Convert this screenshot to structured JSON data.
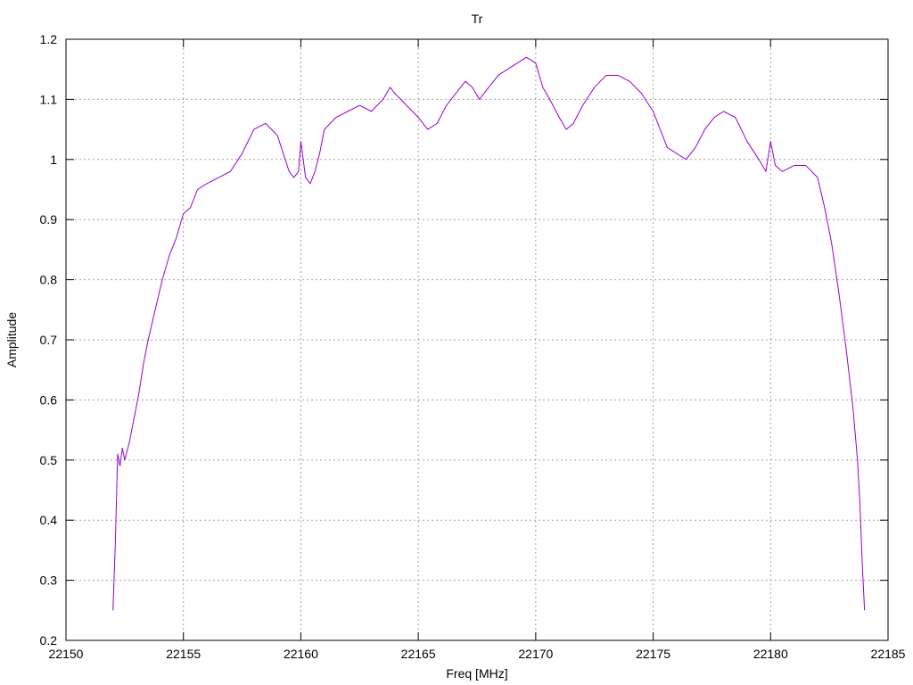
{
  "chart_data": {
    "type": "line",
    "title": "Tr",
    "xlabel": "Freq [MHz]",
    "ylabel": "Amplitude",
    "xlim": [
      22150,
      22185
    ],
    "ylim": [
      0.2,
      1.2
    ],
    "xticks": [
      22150,
      22155,
      22160,
      22165,
      22170,
      22175,
      22180,
      22185
    ],
    "yticks": [
      0.2,
      0.3,
      0.4,
      0.5,
      0.6,
      0.7,
      0.8,
      0.9,
      1,
      1.1,
      1.2
    ],
    "xtick_labels": [
      "22150",
      "22155",
      "22160",
      "22165",
      "22170",
      "22175",
      "22180",
      "22185"
    ],
    "ytick_labels": [
      "0.2",
      "0.3",
      "0.4",
      "0.5",
      "0.6",
      "0.7",
      "0.8",
      "0.9",
      "1",
      "1.1",
      "1.2"
    ],
    "grid": true,
    "legend": "none",
    "series": [
      {
        "color": "#9400d3",
        "x": [
          22152.0,
          22152.1,
          22152.2,
          22152.3,
          22152.4,
          22152.5,
          22152.7,
          22152.9,
          22153.1,
          22153.3,
          22153.5,
          22153.8,
          22154.1,
          22154.4,
          22154.7,
          22155.0,
          22155.3,
          22155.6,
          22156.0,
          22156.5,
          22157.0,
          22157.5,
          22158.0,
          22158.5,
          22159.0,
          22159.5,
          22159.7,
          22159.9,
          22160.0,
          22160.2,
          22160.4,
          22160.6,
          22160.8,
          22161.0,
          22161.5,
          22162.0,
          22162.5,
          22163.0,
          22163.5,
          22163.8,
          22164.0,
          22164.5,
          22165.0,
          22165.4,
          22165.8,
          22166.2,
          22166.6,
          22167.0,
          22167.3,
          22167.6,
          22168.0,
          22168.4,
          22168.8,
          22169.2,
          22169.6,
          22170.0,
          22170.3,
          22170.6,
          22171.0,
          22171.3,
          22171.6,
          22172.0,
          22172.5,
          22173.0,
          22173.5,
          22174.0,
          22174.5,
          22175.0,
          22175.3,
          22175.6,
          22176.0,
          22176.4,
          22176.8,
          22177.2,
          22177.6,
          22178.0,
          22178.5,
          22179.0,
          22179.5,
          22179.8,
          22180.0,
          22180.2,
          22180.5,
          22181.0,
          22181.5,
          22182.0,
          22182.3,
          22182.6,
          22182.9,
          22183.2,
          22183.5,
          22183.7,
          22183.8,
          22183.9,
          22184.0
        ],
        "y": [
          0.25,
          0.36,
          0.51,
          0.49,
          0.52,
          0.5,
          0.53,
          0.57,
          0.61,
          0.66,
          0.7,
          0.75,
          0.8,
          0.84,
          0.87,
          0.91,
          0.92,
          0.95,
          0.96,
          0.97,
          0.98,
          1.01,
          1.05,
          1.06,
          1.04,
          0.98,
          0.97,
          0.98,
          1.03,
          0.97,
          0.96,
          0.98,
          1.01,
          1.05,
          1.07,
          1.08,
          1.09,
          1.08,
          1.1,
          1.12,
          1.11,
          1.09,
          1.07,
          1.05,
          1.06,
          1.09,
          1.11,
          1.13,
          1.12,
          1.1,
          1.12,
          1.14,
          1.15,
          1.16,
          1.17,
          1.16,
          1.12,
          1.1,
          1.07,
          1.05,
          1.06,
          1.09,
          1.12,
          1.14,
          1.14,
          1.13,
          1.11,
          1.08,
          1.05,
          1.02,
          1.01,
          1.0,
          1.02,
          1.05,
          1.07,
          1.08,
          1.07,
          1.03,
          1.0,
          0.98,
          1.03,
          0.99,
          0.98,
          0.99,
          0.99,
          0.97,
          0.92,
          0.86,
          0.78,
          0.69,
          0.59,
          0.5,
          0.43,
          0.33,
          0.25
        ]
      }
    ]
  }
}
